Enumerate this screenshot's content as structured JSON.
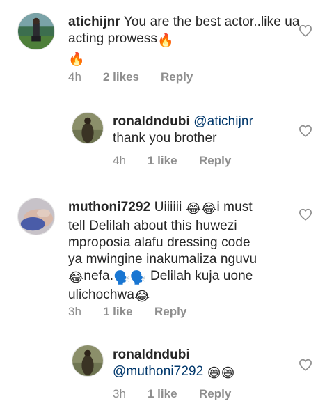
{
  "comments": [
    {
      "username": "atichijnr",
      "text": "You are the best actor..like ua acting prowess",
      "emoji_after": "🔥",
      "emoji_line2": "🔥",
      "time": "4h",
      "likes": "2 likes",
      "reply": "Reply"
    },
    {
      "username": "ronaldndubi",
      "mention": "@atichijnr",
      "text": "thank you brother",
      "time": "4h",
      "likes": "1 like",
      "reply": "Reply"
    },
    {
      "username": "muthoni7292",
      "text_a": "Uiiiiii",
      "emoji_a": "😂😂",
      "text_b": "i must",
      "line2": "tell Delilah about this huwezi",
      "line3": "mproposia alafu dressing code",
      "line4": "ya mwingine inakumaliza nguvu",
      "emoji_c": "😂",
      "text_c": "nefa.",
      "emoji_d": "🗣️🗣️",
      "text_d": "Delilah kuja uone",
      "text_e": "ulichochwa",
      "emoji_e": "😂",
      "time": "3h",
      "likes": "1 like",
      "reply": "Reply"
    },
    {
      "username": "ronaldndubi",
      "mention": "@muthoni7292",
      "emoji": "😅😅",
      "time": "3h",
      "likes": "1 like",
      "reply": "Reply"
    }
  ],
  "colors": {
    "text": "#262626",
    "meta": "#8e8e8e",
    "mention": "#00376b"
  }
}
